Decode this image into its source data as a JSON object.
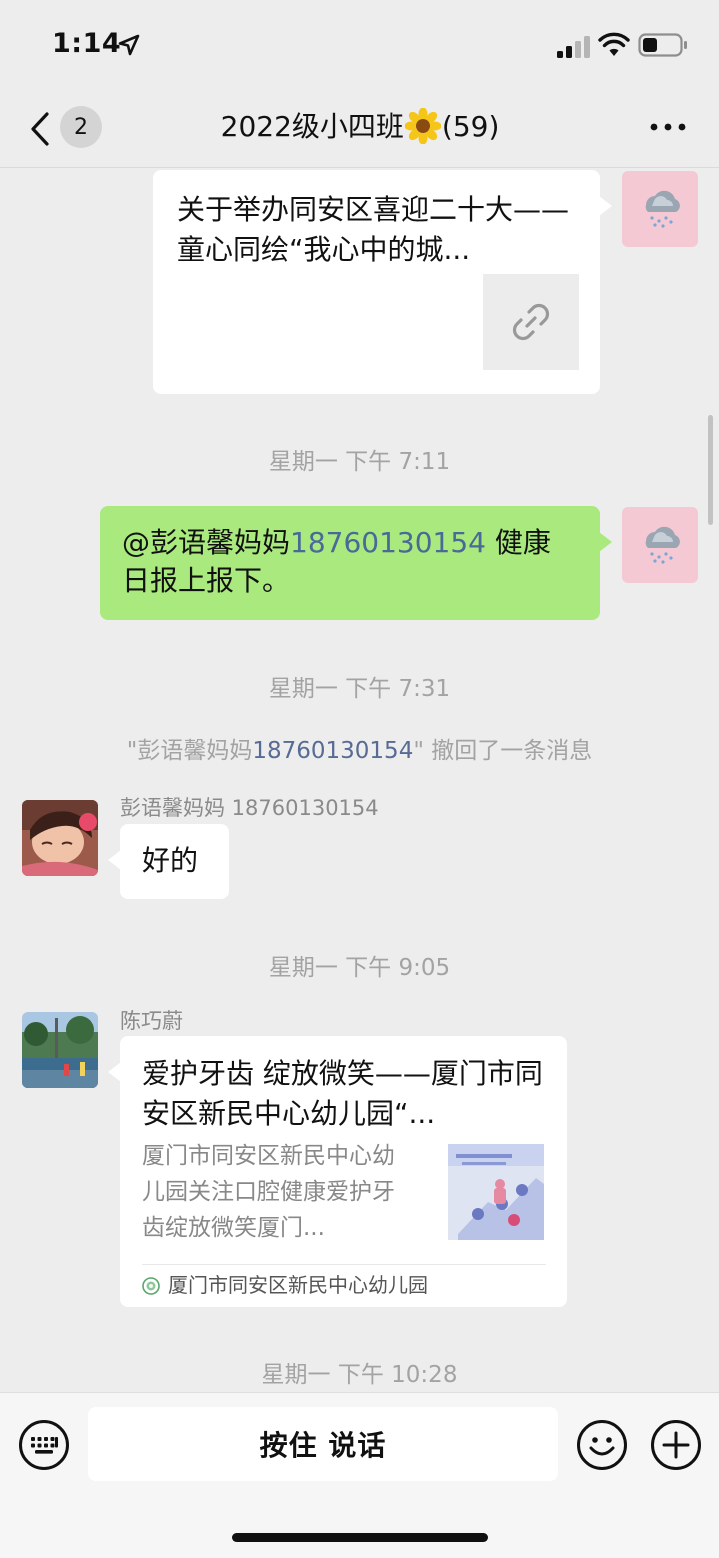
{
  "status_bar": {
    "time": "1:14"
  },
  "nav": {
    "unread_count": "2",
    "title_prefix": "2022级小四班",
    "title_suffix": "(59)"
  },
  "messages": {
    "link_card": {
      "title": "关于举办同安区喜迎二十大——童心同绘“我心中的城..."
    },
    "ts1": "星期一 下午 7:11",
    "own_msg": {
      "mention": "@彭语馨妈妈",
      "phone": "18760130154",
      "rest": " 健康日报上报下。"
    },
    "ts2": "星期一 下午 7:31",
    "recall": {
      "q_open": "\"",
      "name": "彭语馨妈妈",
      "phone": "18760130154",
      "q_close": "\"",
      "rest": " 撤回了一条消息"
    },
    "reply": {
      "sender": "彭语馨妈妈 18760130154",
      "text": "好的"
    },
    "ts3": "星期一 下午 9:05",
    "article": {
      "sender": "陈巧蔚",
      "title": "爱护牙齿 绽放微笑——厦门市同安区新民中心幼儿园“...",
      "desc": "厦门市同安区新民中心幼儿园关注口腔健康爱护牙齿绽放微笑厦门...",
      "source": "厦门市同安区新民中心幼儿园"
    },
    "ts4": "星期一 下午 10:28"
  },
  "input_bar": {
    "talk_label": "按住 说话"
  },
  "colors": {
    "background": "#ededed",
    "own_bubble": "#a9e97d",
    "mention_link": "#576b95"
  }
}
